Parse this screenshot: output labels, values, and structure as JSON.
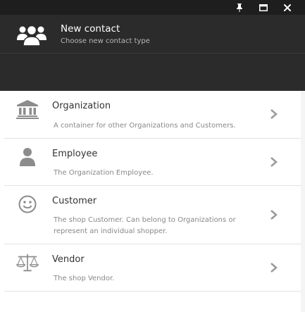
{
  "header": {
    "title": "New contact",
    "subtitle": "Choose new contact type",
    "icon": "users-group-icon"
  },
  "window_controls": {
    "pin": "pin-icon",
    "maximize": "maximize-icon",
    "close": "close-icon"
  },
  "contact_types": [
    {
      "label": "Organization",
      "description": "A container for other Organizations and Customers.",
      "icon": "bank-building-icon"
    },
    {
      "label": "Employee",
      "description": "The Organization Employee.",
      "icon": "person-icon"
    },
    {
      "label": "Customer",
      "description": "The shop Customer. Can belong to Organizations or represent an individual shopper.",
      "icon": "smiley-icon"
    },
    {
      "label": "Vendor",
      "description": "The shop Vendor.",
      "icon": "balance-scale-icon"
    }
  ],
  "colors": {
    "titlebar": "#1e1e1e",
    "header": "#2b2b2b",
    "icon_gray": "#8c8c8c",
    "chevron": "#9a9a9a"
  }
}
